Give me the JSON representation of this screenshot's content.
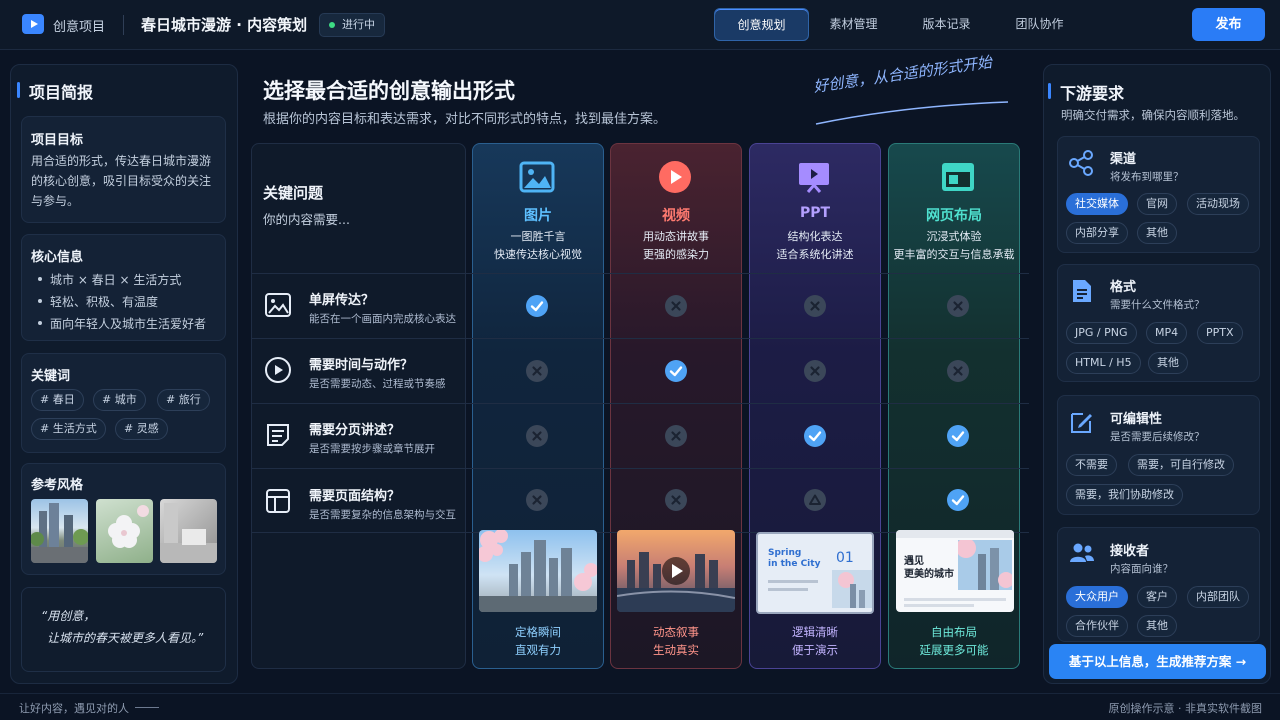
{
  "header": {
    "app_name": "创意项目",
    "project_title": "春日城市漫游 · 内容策划",
    "status": "进行中",
    "tabs": [
      {
        "label": "创意规划",
        "active": true
      },
      {
        "label": "素材管理",
        "active": false
      },
      {
        "label": "版本记录",
        "active": false
      },
      {
        "label": "团队协作",
        "active": false
      }
    ],
    "publish_label": "发布",
    "accent": "#2a7cf6"
  },
  "left_panel": {
    "title": "项目简报",
    "goal": {
      "title": "项目目标",
      "text": "用合适的形式，传达春日城市漫游的核心创意，吸引目标受众的关注与参与。"
    },
    "core_info": {
      "title": "核心信息",
      "bullets": [
        "城市 × 春日 × 生活方式",
        "轻松、积极、有温度",
        "面向年轻人及城市生活爱好者"
      ]
    },
    "keywords": {
      "title": "关键词",
      "tags": [
        "# 春日",
        "# 城市",
        "# 旅行",
        "# 生活方式",
        "# 灵感"
      ]
    },
    "ref_style": {
      "title": "参考风格",
      "images": [
        "city-street-image",
        "cherry-blossom-image",
        "minimal-room-image"
      ]
    },
    "quote": {
      "line1": "“用创意，",
      "line2": "让城市的春天被更多人看见。”"
    }
  },
  "main": {
    "title": "选择最合适的创意输出形式",
    "subtitle": "根据你的内容目标和表达需求，对比不同形式的特点，找到最佳方案。",
    "slogan": "好创意，从合适的形式开始",
    "question_header": {
      "title": "关键问题",
      "subtitle": "你的内容需要..."
    },
    "questions": [
      {
        "icon": "image-icon",
        "title": "单屏传达？",
        "subtitle": "能否在一个画面内完成核心表达"
      },
      {
        "icon": "play-circle-icon",
        "title": "需要时间与动作？",
        "subtitle": "是否需要动态、过程或节奏感"
      },
      {
        "icon": "document-icon",
        "title": "需要分页讲述？",
        "subtitle": "是否需要按步骤或章节展开"
      },
      {
        "icon": "layout-icon",
        "title": "需要页面结构？",
        "subtitle": "是否需要复杂的信息架构与交互"
      }
    ],
    "formats": [
      {
        "name": "图片",
        "desc1": "一图胜千言",
        "desc2": "快速传达核心视觉",
        "icon": "image-icon",
        "color": "#4fb4f5",
        "marks": [
          "check",
          "cross",
          "cross",
          "cross"
        ],
        "caption1": "定格瞬间",
        "caption2": "直观有力"
      },
      {
        "name": "视频",
        "desc1": "用动态讲故事",
        "desc2": "更强的感染力",
        "icon": "play-icon",
        "color": "#ff6b62",
        "marks": [
          "cross",
          "check",
          "cross",
          "cross"
        ],
        "caption1": "动态叙事",
        "caption2": "生动真实"
      },
      {
        "name": "PPT",
        "desc1": "结构化表达",
        "desc2": "适合系统化讲述",
        "icon": "presentation-icon",
        "color": "#a58cff",
        "marks": [
          "cross",
          "cross",
          "check",
          "tri"
        ],
        "caption1": "逻辑清晰",
        "caption2": "便于演示"
      },
      {
        "name": "网页布局",
        "desc1": "沉浸式体验",
        "desc2": "更丰富的交互与信息承载",
        "icon": "browser-icon",
        "color": "#3fd6c6",
        "marks": [
          "cross",
          "cross",
          "check",
          "check"
        ],
        "caption1": "自由布局",
        "caption2": "延展更多可能"
      }
    ],
    "ppt_preview": {
      "title1": "Spring",
      "title2": "in the City",
      "number": "01"
    },
    "web_preview": {
      "title1": "遇见",
      "title2": "更美的城市"
    }
  },
  "right_panel": {
    "title": "下游要求",
    "subtitle": "明确交付需求，确保内容顺利落地。",
    "sections": [
      {
        "title": "渠道",
        "question": "将发布到哪里？",
        "icon": "share-icon",
        "options": [
          "社交媒体",
          "官网",
          "活动现场",
          "内部分享",
          "其他"
        ],
        "selected": "社交媒体"
      },
      {
        "title": "格式",
        "question": "需要什么文件格式？",
        "icon": "file-icon",
        "options": [
          "JPG / PNG",
          "MP4",
          "PPTX",
          "HTML / H5",
          "其他"
        ],
        "selected": ""
      },
      {
        "title": "可编辑性",
        "question": "是否需要后续修改？",
        "icon": "edit-icon",
        "options": [
          "不需要",
          "需要，可自行修改",
          "需要，我们协助修改"
        ],
        "selected": ""
      },
      {
        "title": "接收者",
        "question": "内容面向谁？",
        "icon": "users-icon",
        "options": [
          "大众用户",
          "客户",
          "内部团队",
          "合作伙伴",
          "其他"
        ],
        "selected": "大众用户"
      }
    ],
    "cta_label": "基于以上信息，生成推荐方案 →"
  },
  "footer": {
    "left": "让好内容，遇见对的人",
    "right": "原创操作示意 · 非真实软件截图"
  }
}
